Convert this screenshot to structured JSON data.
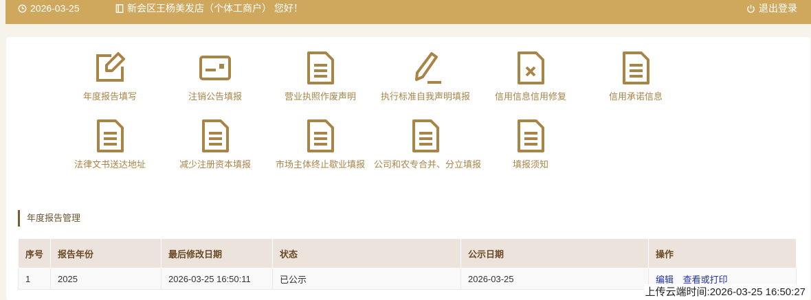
{
  "colors": {
    "bar": "#cfa75d",
    "icon": "#a98447",
    "label": "#a98447",
    "table_head": "#ece3dc",
    "link": "#2233aa"
  },
  "header": {
    "date": "2026-03-25",
    "greeting": "新会区王杨美发店（个体工商户） 您好！",
    "logout": "退出登录",
    "icons": {
      "date": "clock-icon",
      "shop": "book-icon",
      "logout": "power-icon"
    }
  },
  "menu": [
    {
      "label": "年度报告填写",
      "icon": "edit-icon"
    },
    {
      "label": "注销公告填报",
      "icon": "card-icon"
    },
    {
      "label": "营业执照作废声明",
      "icon": "document-icon"
    },
    {
      "label": "执行标准自我声明填报",
      "icon": "pencil-icon"
    },
    {
      "label": "信用信息信用修复",
      "icon": "document-x-icon"
    },
    {
      "label": "信用承诺信息",
      "icon": "document-icon"
    },
    {
      "label": "法律文书送达地址",
      "icon": "document-icon"
    },
    {
      "label": "减少注册资本填报",
      "icon": "document-icon"
    },
    {
      "label": "市场主体终止歇业填报",
      "icon": "document-icon"
    },
    {
      "label": "公司和农专合并、分立填报",
      "icon": "document-icon"
    },
    {
      "label": "填报须知",
      "icon": "document-icon"
    }
  ],
  "section": {
    "title": "年度报告管理"
  },
  "table": {
    "headers": [
      "序号",
      "报告年份",
      "最后修改日期",
      "状态",
      "公示日期",
      "操作"
    ],
    "rows": [
      {
        "no": "1",
        "year": "2025",
        "modified": "2026-03-25 16:50:11",
        "status": "已公示",
        "published": "2026-03-25",
        "actions": [
          "编辑",
          "查看或打印"
        ]
      }
    ]
  },
  "upload_time": "上传云端时间:2026-03-25 16:50:27"
}
